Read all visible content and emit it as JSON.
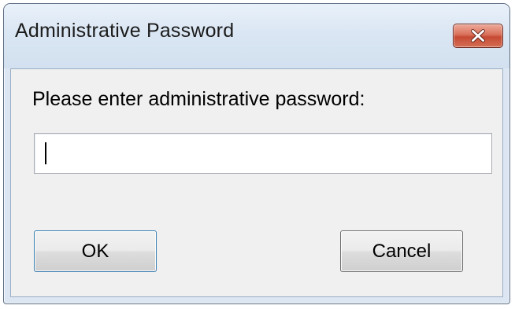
{
  "dialog": {
    "title": "Administrative Password",
    "close_icon": "close-icon",
    "prompt": "Please enter administrative password:",
    "password": {
      "value": "",
      "placeholder": ""
    },
    "buttons": {
      "ok_label": "OK",
      "cancel_label": "Cancel"
    }
  },
  "colors": {
    "title_bar": "#dae6f3",
    "client_background": "#f0f0f0",
    "close_button": "#c54a33",
    "default_button_border": "#3c7fb1"
  }
}
